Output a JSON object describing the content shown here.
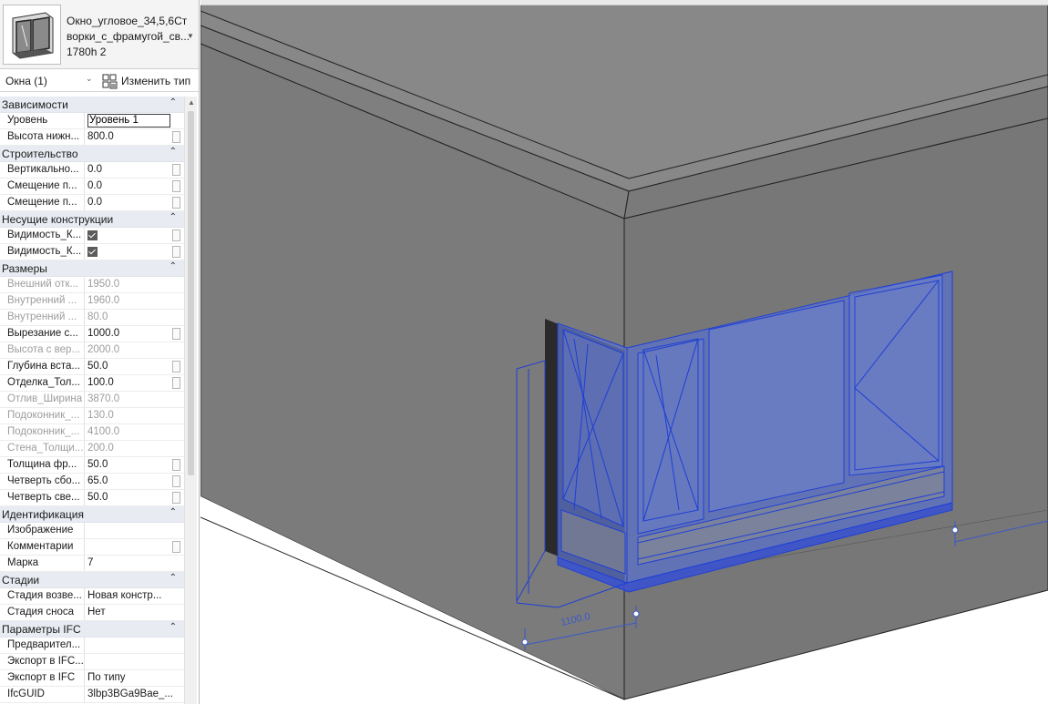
{
  "palette": {
    "type_selector": {
      "name_line1": "Окно_угловое_34,5,6Ст",
      "name_line2": "ворки_с_фрамугой_св...",
      "name_line3": "1780h 2"
    },
    "filter": {
      "label": "Окна (1)"
    },
    "edit_type_label": "Изменить тип",
    "groups": [
      {
        "label": "Зависимости",
        "rows": [
          {
            "key": "Уровень",
            "value": "Уровень 1",
            "kind": "input"
          },
          {
            "key": "Высота нижн...",
            "value": "800.0",
            "kind": "text",
            "edit_button": true
          }
        ]
      },
      {
        "label": "Строительство",
        "rows": [
          {
            "key": "Вертикально...",
            "value": "0.0",
            "kind": "text",
            "edit_button": true
          },
          {
            "key": "Смещение п...",
            "value": "0.0",
            "kind": "text",
            "edit_button": true
          },
          {
            "key": "Смещение п...",
            "value": "0.0",
            "kind": "text",
            "edit_button": true
          }
        ]
      },
      {
        "label": "Несущие конструкции",
        "rows": [
          {
            "key": "Видимость_К...",
            "value": "",
            "kind": "checkbox",
            "edit_button": true
          },
          {
            "key": "Видимость_К...",
            "value": "",
            "kind": "checkbox",
            "edit_button": true
          }
        ]
      },
      {
        "label": "Размеры",
        "rows": [
          {
            "key": "Внешний отк...",
            "value": "1950.0",
            "kind": "text",
            "disabled": true
          },
          {
            "key": "Внутренний ...",
            "value": "1960.0",
            "kind": "text",
            "disabled": true
          },
          {
            "key": "Внутренний ...",
            "value": "80.0",
            "kind": "text",
            "disabled": true
          },
          {
            "key": "Вырезание с...",
            "value": "1000.0",
            "kind": "text",
            "edit_button": true
          },
          {
            "key": "Высота с вер...",
            "value": "2000.0",
            "kind": "text",
            "disabled": true
          },
          {
            "key": "Глубина вста...",
            "value": "50.0",
            "kind": "text",
            "edit_button": true
          },
          {
            "key": "Отделка_Тол...",
            "value": "100.0",
            "kind": "text",
            "edit_button": true
          },
          {
            "key": "Отлив_Ширина",
            "value": "3870.0",
            "kind": "text",
            "disabled": true
          },
          {
            "key": "Подоконник_...",
            "value": "130.0",
            "kind": "text",
            "disabled": true
          },
          {
            "key": "Подоконник_...",
            "value": "4100.0",
            "kind": "text",
            "disabled": true
          },
          {
            "key": "Стена_Толщи...",
            "value": "200.0",
            "kind": "text",
            "disabled": true
          },
          {
            "key": "Толщина фр...",
            "value": "50.0",
            "kind": "text",
            "edit_button": true
          },
          {
            "key": "Четверть сбо...",
            "value": "65.0",
            "kind": "text",
            "edit_button": true
          },
          {
            "key": "Четверть све...",
            "value": "50.0",
            "kind": "text",
            "edit_button": true
          }
        ]
      },
      {
        "label": "Идентификация",
        "rows": [
          {
            "key": "Изображение",
            "value": "",
            "kind": "text"
          },
          {
            "key": "Комментарии",
            "value": "",
            "kind": "text",
            "edit_button": true
          },
          {
            "key": "Марка",
            "value": "7",
            "kind": "text"
          }
        ]
      },
      {
        "label": "Стадии",
        "rows": [
          {
            "key": "Стадия возве...",
            "value": "Новая констр...",
            "kind": "text"
          },
          {
            "key": "Стадия сноса",
            "value": "Нет",
            "kind": "text"
          }
        ]
      },
      {
        "label": "Параметры IFC",
        "rows": [
          {
            "key": "Предварител...",
            "value": "",
            "kind": "text"
          },
          {
            "key": "Экспорт в IFC...",
            "value": "",
            "kind": "text"
          },
          {
            "key": "Экспорт в IFC",
            "value": "По типу",
            "kind": "text"
          },
          {
            "key": "IfcGUID",
            "value": "3lbp3BGa9Bae_...",
            "kind": "text"
          }
        ]
      }
    ]
  },
  "viewport": {
    "dimension_value": "1100.0",
    "colors": {
      "wall": "#7a7a7a",
      "wall_side": "#767676",
      "selection": "#1f3fd6",
      "glass": "#5d72c4"
    }
  }
}
